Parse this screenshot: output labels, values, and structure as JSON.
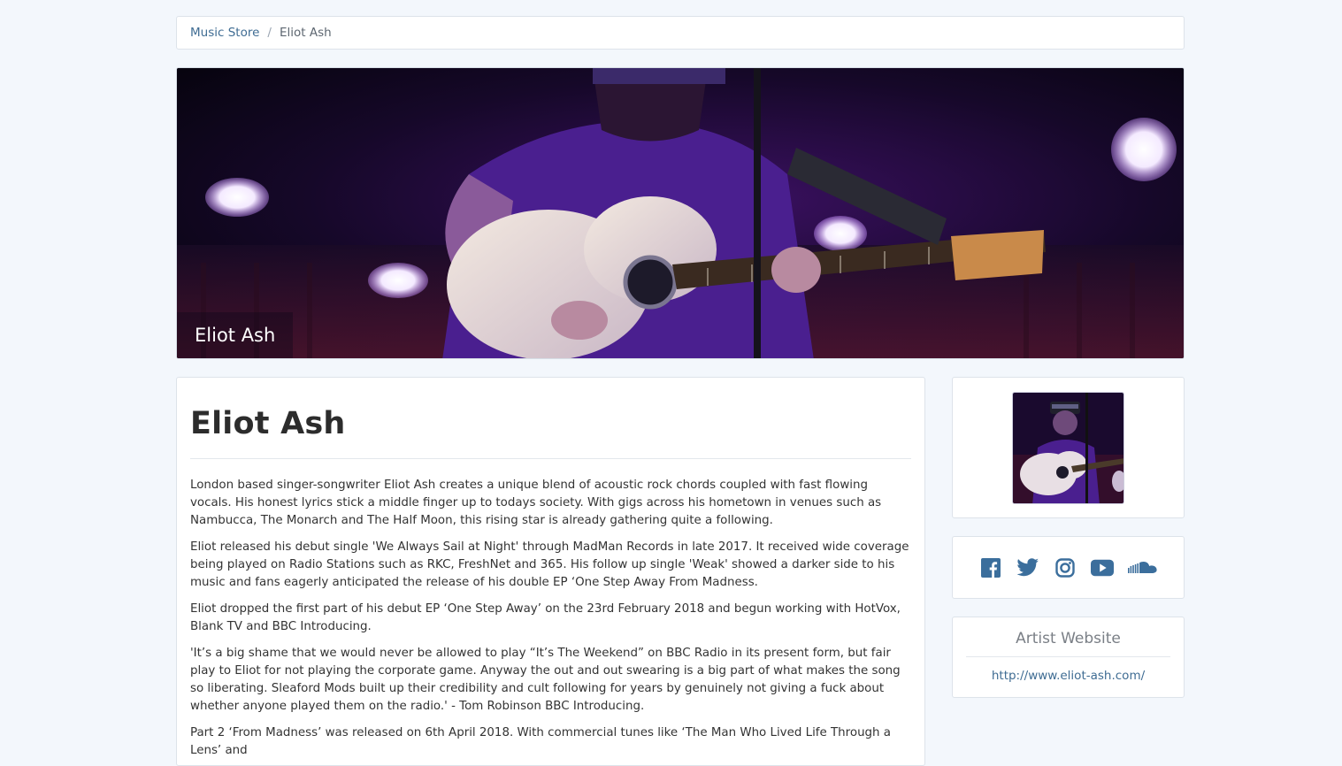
{
  "breadcrumb": {
    "root": "Music Store",
    "separator": "/",
    "current": "Eliot Ash"
  },
  "hero": {
    "caption": "Eliot Ash"
  },
  "main": {
    "title": "Eliot Ash",
    "paragraphs": [
      "London based singer-songwriter Eliot Ash creates a unique blend of acoustic rock chords coupled with fast flowing vocals. His honest lyrics stick a middle finger up to todays society. With gigs across his hometown in venues such as Nambucca, The Monarch and The Half Moon, this rising star is already gathering quite a following.",
      "Eliot released his debut single 'We Always Sail at Night' through MadMan Records in late 2017. It received wide coverage being played on Radio Stations such as RKC, FreshNet and 365. His follow up single 'Weak' showed a darker side to his music and fans eagerly anticipated the release of his double EP ‘One Step Away From Madness.",
      "Eliot dropped the first part of his debut EP ‘One Step Away’ on the 23rd February 2018 and begun working with HotVox, Blank TV and BBC Introducing.",
      "'It’s a big shame that we would never be allowed to play “It’s The Weekend” on BBC Radio in its present form, but fair play to Eliot for not playing the corporate game. Anyway the out and out swearing is a big part of what makes the song so liberating. Sleaford Mods built up their credibility and cult following for years by genuinely not giving a fuck about whether anyone played them on the radio.' - Tom Robinson BBC Introducing.",
      "Part 2 ‘From Madness’ was released on 6th April 2018. With commercial tunes like ‘The Man Who Lived Life Through a Lens’ and"
    ]
  },
  "sidebar": {
    "social": [
      {
        "icon": "facebook-icon",
        "color": "#3b6e9c"
      },
      {
        "icon": "twitter-icon",
        "color": "#3b6e9c"
      },
      {
        "icon": "instagram-icon",
        "color": "#3b6e9c"
      },
      {
        "icon": "youtube-icon",
        "color": "#3b6e9c"
      },
      {
        "icon": "soundcloud-icon",
        "color": "#3b6e9c"
      }
    ],
    "website": {
      "title": "Artist Website",
      "url": "http://www.eliot-ash.com/"
    }
  },
  "colors": {
    "link": "#3f6c93",
    "page_bg": "#f3f7fc",
    "icon": "#3b6e9c"
  }
}
